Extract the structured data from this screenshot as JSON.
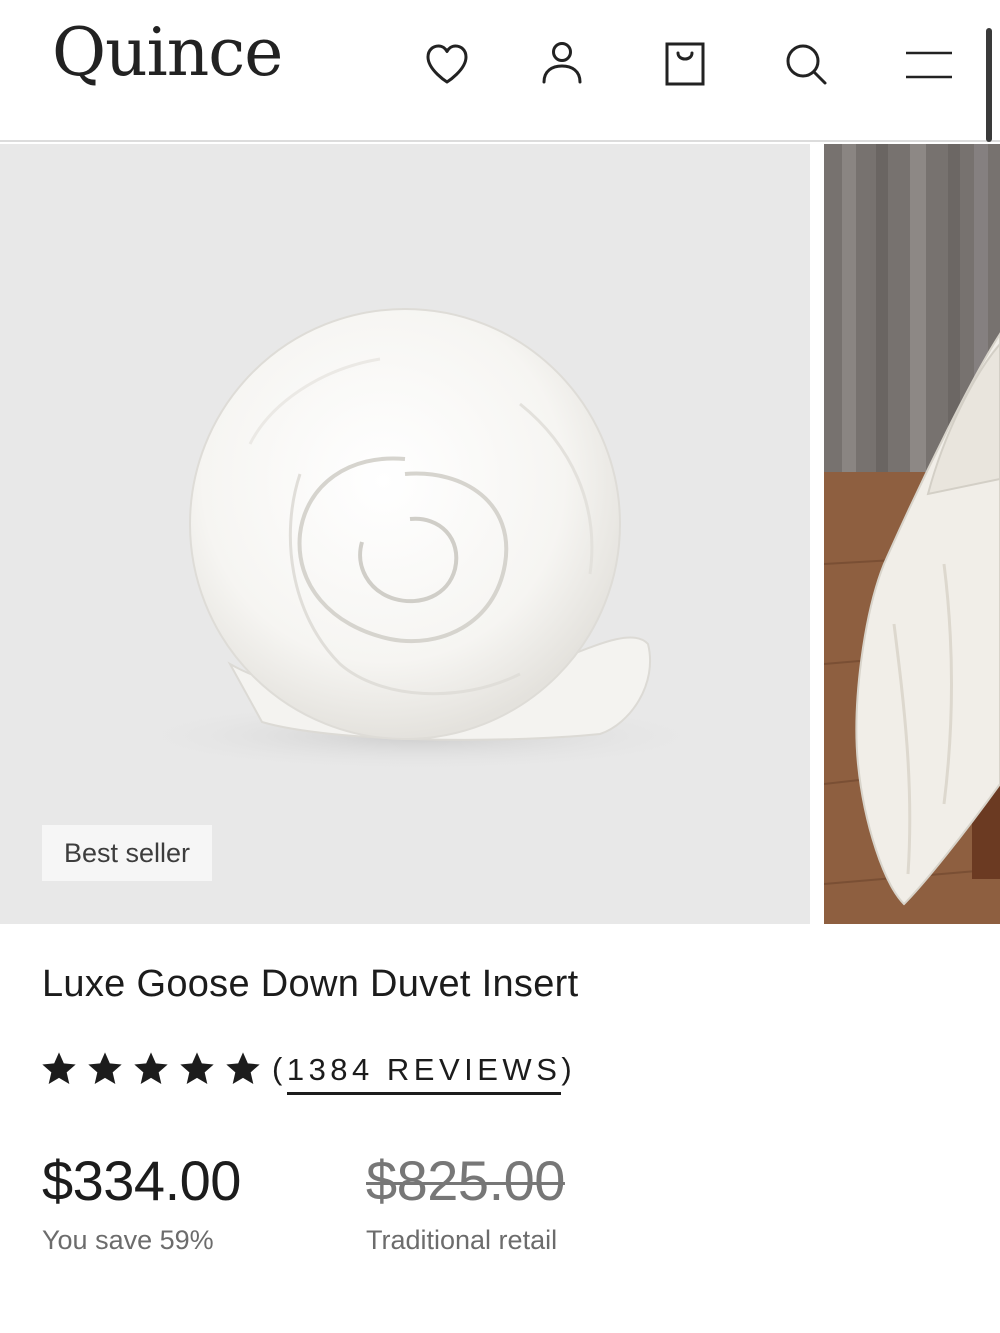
{
  "header": {
    "logo": "Quince",
    "icons": [
      "heart-icon",
      "account-icon",
      "shopping-bag-icon",
      "search-icon",
      "menu-icon"
    ]
  },
  "gallery": {
    "badge": "Best seller"
  },
  "product": {
    "title": "Luxe Goose Down Duvet Insert",
    "rating": 5,
    "rating_max": 5,
    "reviews_open": "(",
    "reviews_text": "1384 REVIEWS",
    "reviews_close": ")",
    "price": "$334.00",
    "savings": "You save 59%",
    "old_price": "$825.00",
    "old_price_label": "Traditional retail"
  },
  "colors": {
    "text": "#1c1c1c",
    "muted": "#6c6c6c",
    "image_bg": "#e8e8e8",
    "divider": "#dcdcdc"
  }
}
